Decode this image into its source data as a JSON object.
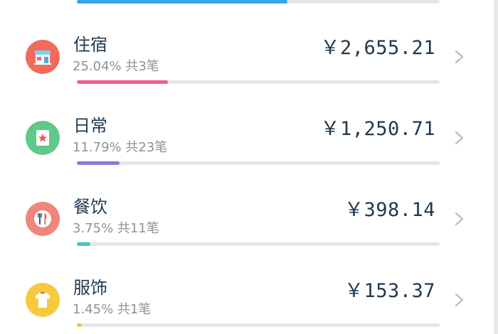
{
  "colors": {
    "top": "#35a6e6",
    "lodging": "#ee5f94",
    "daily": "#8d7bd8",
    "dining": "#47c0c7",
    "apparel": "#f3c43f"
  },
  "top_bar": {
    "progress_pct": 58
  },
  "items": [
    {
      "name": "住宿",
      "stats": "25.04% 共3笔",
      "amount": "￥2,655.21",
      "progress_pct": 25.04,
      "icon": "shop-icon"
    },
    {
      "name": "日常",
      "stats": "11.79% 共23笔",
      "amount": "￥1,250.71",
      "progress_pct": 11.79,
      "icon": "card-star-icon"
    },
    {
      "name": "餐饮",
      "stats": "3.75% 共11笔",
      "amount": "￥398.14",
      "progress_pct": 3.75,
      "icon": "fork-knife-icon"
    },
    {
      "name": "服饰",
      "stats": "1.45% 共1笔",
      "amount": "￥153.37",
      "progress_pct": 1.45,
      "icon": "shirt-icon"
    }
  ]
}
